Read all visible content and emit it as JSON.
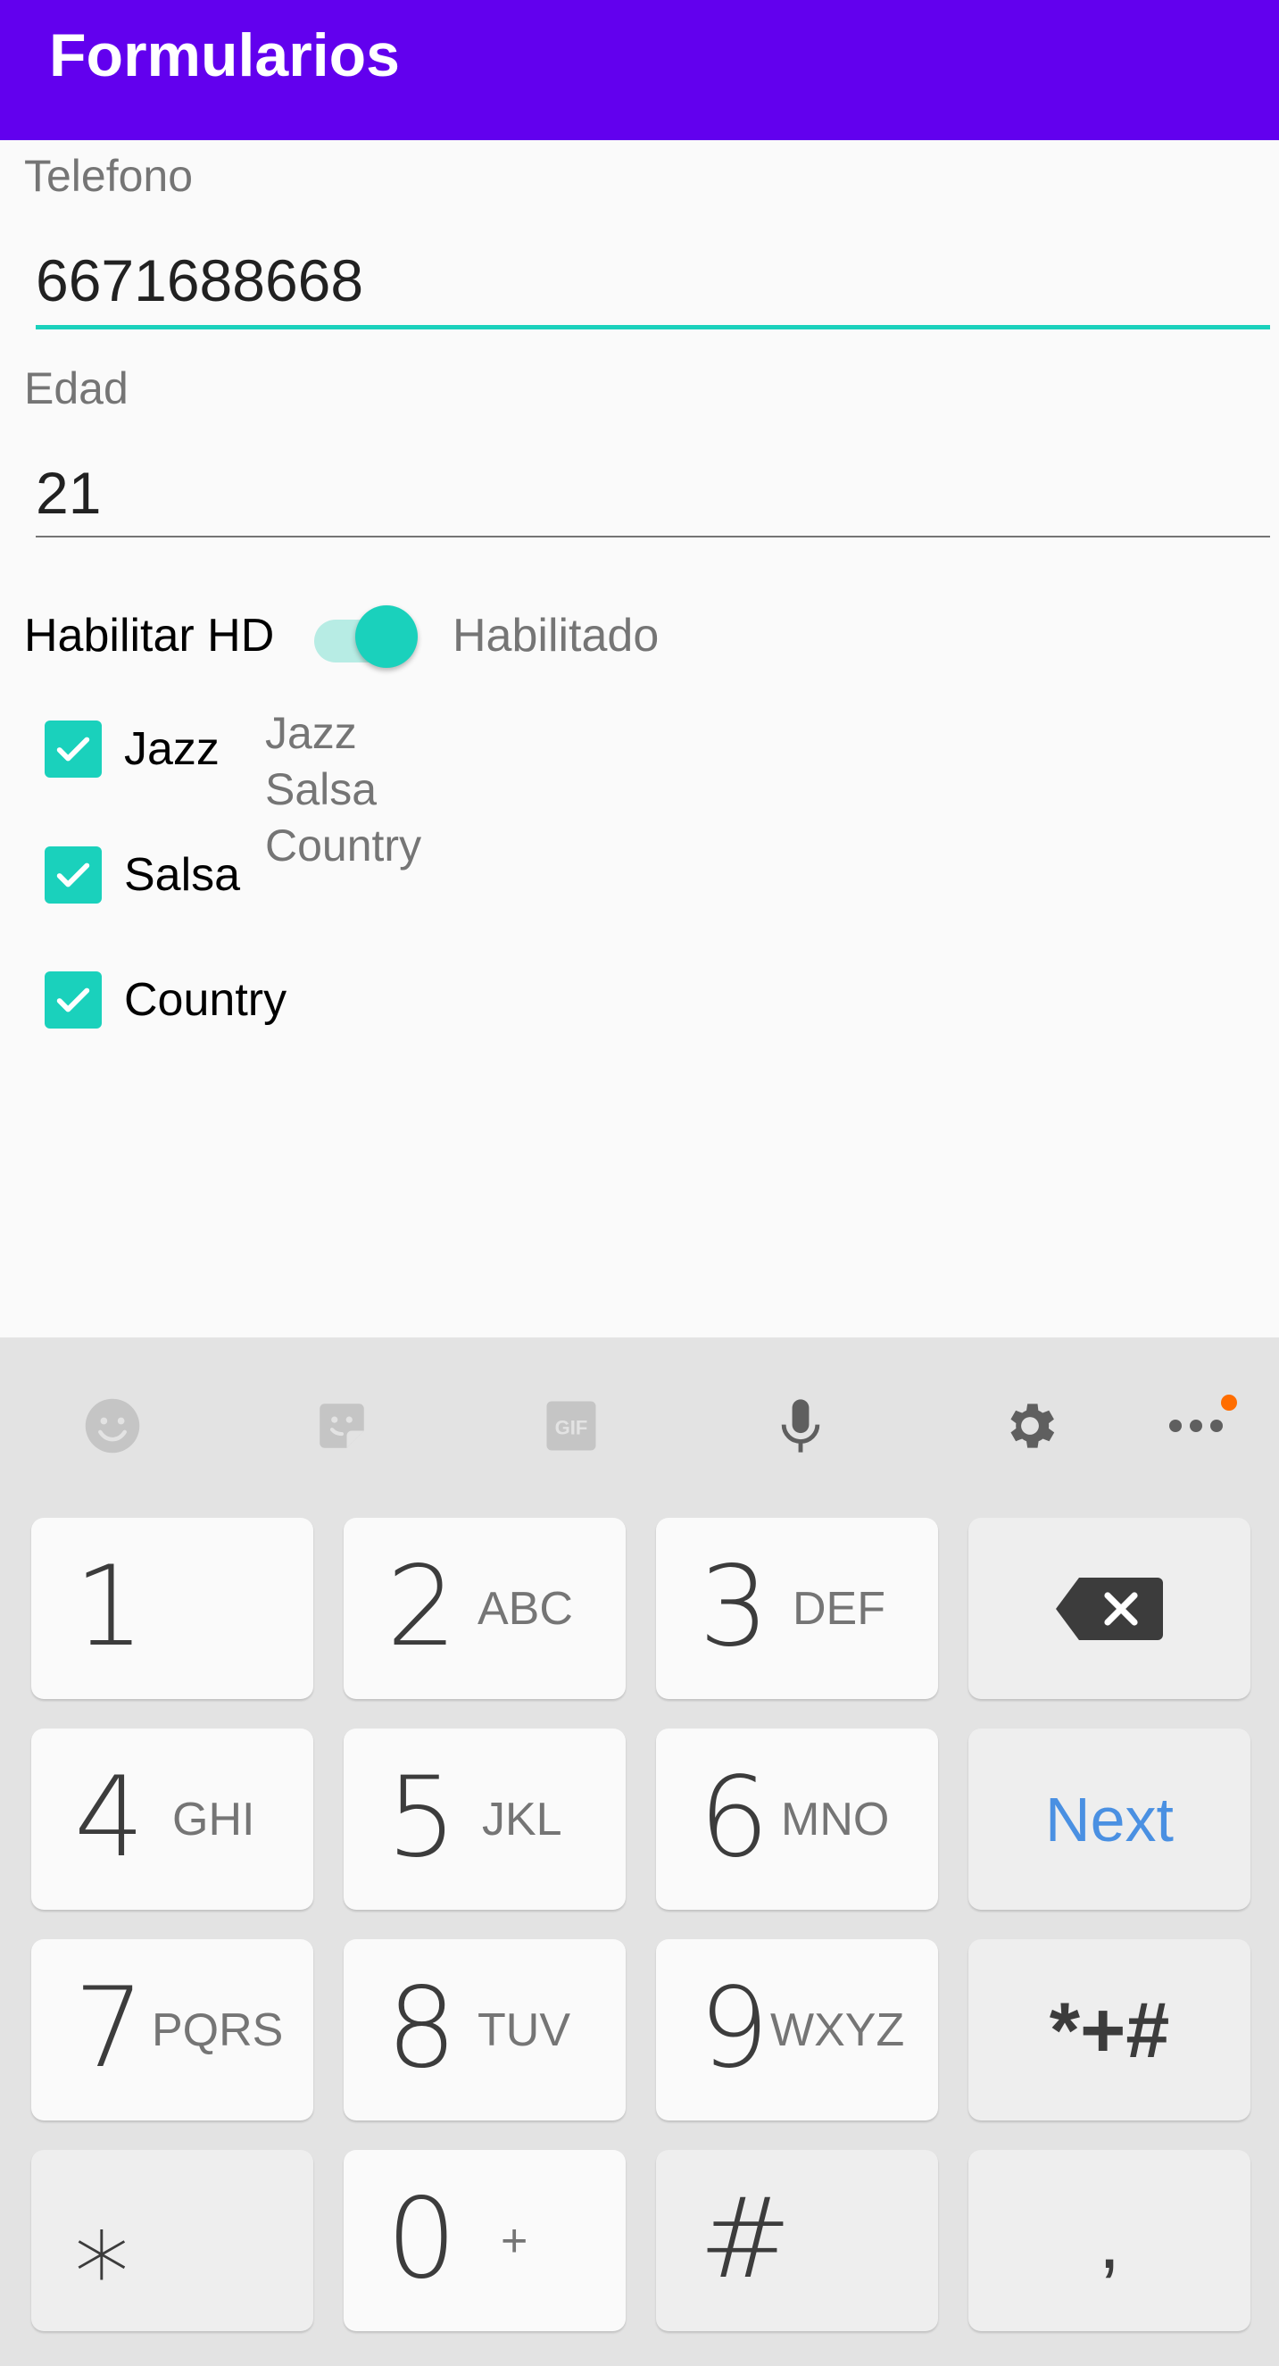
{
  "appbar": {
    "title": "Formularios",
    "color": "#6200ee"
  },
  "form": {
    "telefono": {
      "label": "Telefono",
      "value": "6671688668"
    },
    "edad": {
      "label": "Edad",
      "value": "21"
    },
    "hd": {
      "label": "Habilitar HD",
      "checked": true,
      "state": "Habilitado"
    },
    "checkboxes": [
      {
        "label": "Jazz",
        "checked": true
      },
      {
        "label": "Salsa",
        "checked": true
      },
      {
        "label": "Country",
        "checked": true
      }
    ],
    "selected": [
      "Jazz",
      "Salsa",
      "Country"
    ],
    "accent": "#1ad1bc"
  },
  "keyboard": {
    "toolbar": [
      "emoji-icon",
      "sticker-icon",
      "gif-icon",
      "mic-icon",
      "settings-icon",
      "more-icon"
    ],
    "gif_text": "GIF",
    "keys": [
      {
        "main": "1",
        "sub": ""
      },
      {
        "main": "2",
        "sub": "ABC"
      },
      {
        "main": "3",
        "sub": "DEF"
      },
      {
        "main": "",
        "sub": "",
        "icon": "backspace-icon"
      },
      {
        "main": "4",
        "sub": "GHI"
      },
      {
        "main": "5",
        "sub": "JKL"
      },
      {
        "main": "6",
        "sub": "MNO"
      },
      {
        "main": "Next",
        "sub": ""
      },
      {
        "main": "7",
        "sub": "PQRS"
      },
      {
        "main": "8",
        "sub": "TUV"
      },
      {
        "main": "9",
        "sub": "WXYZ"
      },
      {
        "main": "*+#",
        "sub": ""
      },
      {
        "main": "⁎",
        "sub": ""
      },
      {
        "main": "0",
        "sub": "+"
      },
      {
        "main": "#",
        "sub": ""
      },
      {
        "main": ",",
        "sub": ""
      }
    ]
  }
}
